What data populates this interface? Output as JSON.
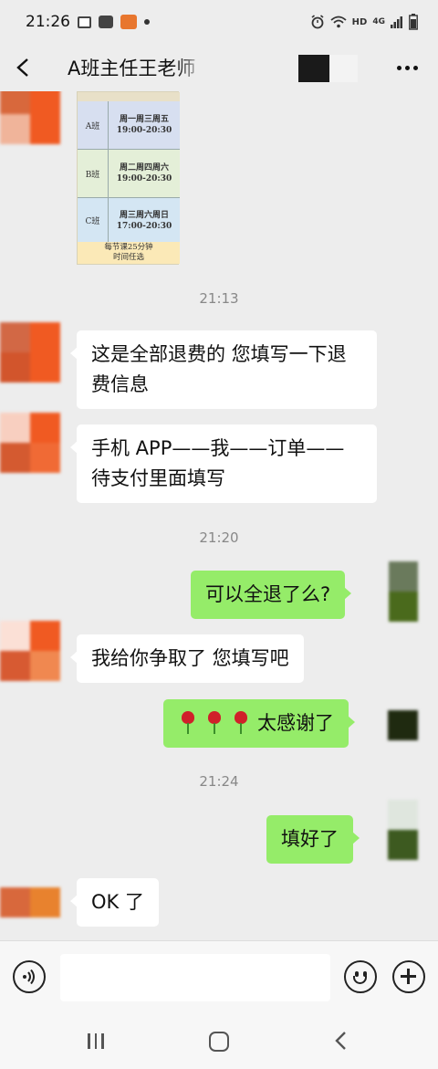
{
  "status_bar": {
    "time": "21:26",
    "network": "HD",
    "network_gen": "4G"
  },
  "header": {
    "title": "A班主任王老师",
    "back_icon": "chevron-left-icon",
    "more_icon": "more-dots-icon"
  },
  "schedule_image": {
    "rows": [
      {
        "class": "A班",
        "days": "周一周三周五",
        "time": "19:00-20:30"
      },
      {
        "class": "B班",
        "days": "周二周四周六",
        "time": "19:00-20:30"
      },
      {
        "class": "C班",
        "days": "周三周六周日",
        "time": "17:00-20:30"
      }
    ],
    "footer_line1": "每节课25分钟",
    "footer_line2": "时间任选"
  },
  "messages": {
    "ts1": "21:13",
    "m1": "这是全部退费的 您填写一下退费信息",
    "m2": "手机 APP——我——订单——待支付里面填写",
    "ts2": "21:20",
    "m3": "可以全退了么?",
    "m4": "我给你争取了 您填写吧",
    "m5_text": "太感谢了",
    "ts3": "21:24",
    "m6": "填好了",
    "m7": "OK 了"
  },
  "input": {
    "placeholder": ""
  },
  "colors": {
    "background": "#ededed",
    "bubble_self": "#95ec69",
    "bubble_other": "#ffffff"
  }
}
